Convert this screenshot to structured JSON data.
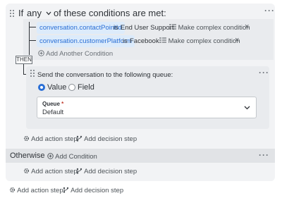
{
  "condition": {
    "if_label": "If",
    "match_mode": "any",
    "suffix": "of these conditions are met:",
    "rows": [
      {
        "variable": "conversation.contactPointId",
        "operator": "is",
        "value": "End User Support",
        "complex_label": "Make complex condition",
        "remove_label": "×"
      },
      {
        "variable": "conversation.customerPlatform",
        "operator": "is",
        "value": "Facebook",
        "complex_label": "Make complex condition",
        "remove_label": "×"
      }
    ],
    "add_another_label": "Add Another Condition"
  },
  "then_label": "THEN",
  "action": {
    "title": "Send the conversation to the following queue:",
    "radio_options": [
      {
        "label": "Value",
        "checked": true
      },
      {
        "label": "Field",
        "checked": false
      }
    ],
    "queue_field": {
      "label": "Queue",
      "required_mark": "*",
      "value": "Default"
    }
  },
  "branch_steps": {
    "add_action": "Add action step",
    "add_decision": "Add decision step"
  },
  "otherwise": {
    "label": "Otherwise",
    "add_condition": "Add Condition",
    "add_action": "Add action step",
    "add_decision": "Add decision step"
  },
  "root_steps": {
    "add_action": "Add action step",
    "add_decision": "Add decision step"
  },
  "menu_glyph": "···",
  "colors": {
    "accent": "#2a6fd6",
    "chip_bg": "#dcebfb",
    "card_bg": "#f2f3f5",
    "required": "#c0392b"
  }
}
